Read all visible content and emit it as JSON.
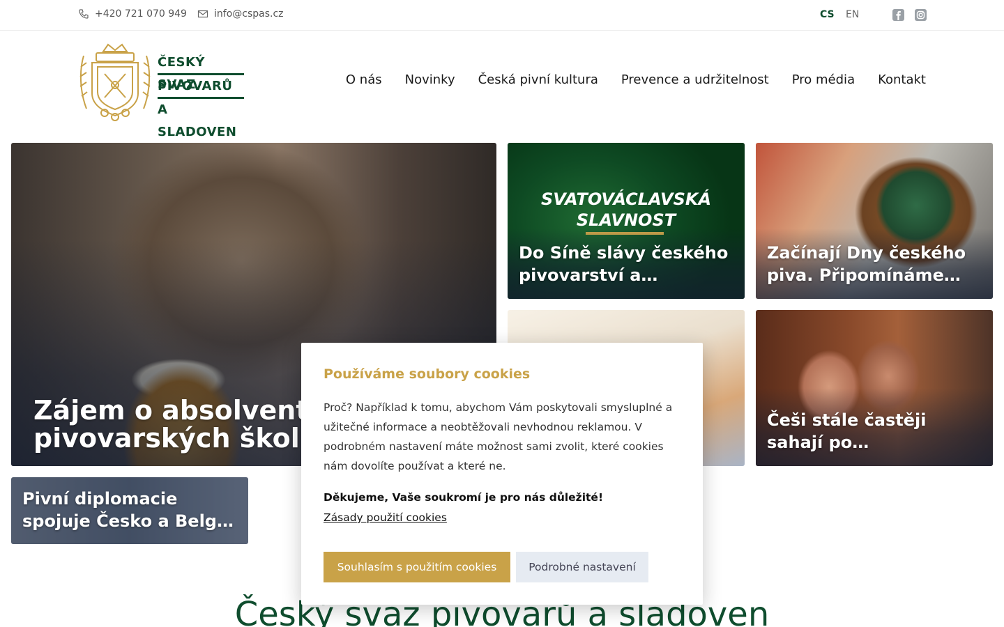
{
  "topbar": {
    "phone": "+420 721 070 949",
    "email": "info@cspas.cz",
    "lang_cs": "CS",
    "lang_en": "EN",
    "social": [
      "facebook-icon",
      "instagram-icon"
    ]
  },
  "logo": {
    "line1": "ČESKÝ SVAZ",
    "line2": "PIVOVARŮ",
    "line3": "A SLADOVEN",
    "gold": "#c9a248",
    "green": "#0f4d2e"
  },
  "nav": [
    "O nás",
    "Novinky",
    "Česká pivní kultura",
    "Prevence a udržitelnost",
    "Pro média",
    "Kontakt"
  ],
  "tiles": {
    "main": "Zájem o absolventy pivovarských škol j…",
    "svatovaclavska_brand_line1": "SVATOVÁCLAVSKÁ",
    "svatovaclavska_brand_line2": "SLAVNOST",
    "svatovaclavska": "Do Síně slávy českého pivovarství a…",
    "dny": "Začínají Dny českého piva. Připomínáme…",
    "cesi": "Češi stále častěji sahají po…",
    "diplomacie": "Pivní diplomacie spojuje Česko a Belg…"
  },
  "section_title": "Český svaz pivovarů a sladoven",
  "cookie": {
    "title": "Používáme soubory cookies",
    "body": "Proč? Například k tomu, abychom Vám poskytovali smysluplné a užitečné informace a neobtěžovali nevhodnou reklamou. V podrobném nastavení máte možnost sami zvolit, které cookies nám dovolíte používat a které ne.",
    "thanks": "Děkujeme, Vaše soukromí je pro nás důležité!",
    "policy_link": "Zásady použití cookies",
    "accept": "Souhlasím s použitím cookies",
    "details": "Podrobné nastavení"
  }
}
